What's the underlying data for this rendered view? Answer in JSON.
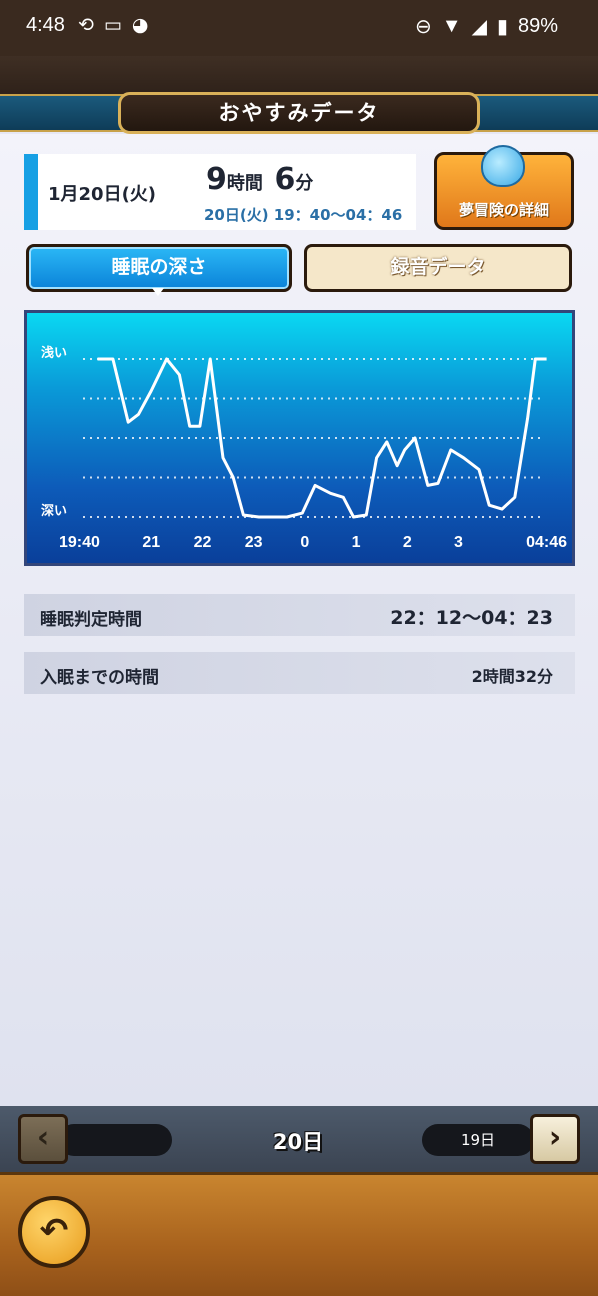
{
  "status_bar": {
    "time": "4:48",
    "battery": "89%"
  },
  "title": "おやすみデータ",
  "summary": {
    "date": "1月20日(火)",
    "hours": "9",
    "hours_unit": "時間",
    "minutes": "6",
    "minutes_unit": "分",
    "range": "20日(火) 19：40～04：46"
  },
  "adventure_button": "夢冒険の詳細",
  "tabs": {
    "depth": "睡眠の深さ",
    "recording": "録音データ"
  },
  "chart_data": {
    "type": "line",
    "ylabels": {
      "top": "浅い",
      "bottom": "深い"
    },
    "x_tick_labels": [
      "19:40",
      "21",
      "22",
      "23",
      "0",
      "1",
      "2",
      "3",
      "04:46"
    ],
    "x_tick_hours": [
      19.667,
      21,
      22,
      23,
      24,
      25,
      26,
      27,
      28.767
    ],
    "ylim": [
      0,
      4
    ],
    "x": [
      19.95,
      20.25,
      20.55,
      20.75,
      21.0,
      21.3,
      21.55,
      21.75,
      21.95,
      22.15,
      22.4,
      22.6,
      22.8,
      23.1,
      23.4,
      23.65,
      23.95,
      24.2,
      24.5,
      24.75,
      24.95,
      25.2,
      25.4,
      25.6,
      25.8,
      25.95,
      26.15,
      26.4,
      26.6,
      26.85,
      27.1,
      27.4,
      27.6,
      27.85,
      28.1,
      28.35,
      28.5,
      28.72
    ],
    "y": [
      4,
      4,
      2.4,
      2.6,
      3.2,
      4,
      3.6,
      2.3,
      2.3,
      4,
      1.5,
      1,
      0.05,
      0,
      0,
      0,
      0.1,
      0.8,
      0.6,
      0.5,
      0,
      0.05,
      1.5,
      1.9,
      1.3,
      1.7,
      2.0,
      0.8,
      0.85,
      1.7,
      1.5,
      1.2,
      0.3,
      0.2,
      0.5,
      2.5,
      4,
      4
    ],
    "grid": true
  },
  "rows": [
    {
      "label": "睡眠判定時間",
      "value": "22：12～04：23"
    },
    {
      "label": "入眠までの時間",
      "value": "2時間32分"
    }
  ],
  "nav": {
    "current": "20日",
    "next": "19日",
    "prev": ""
  },
  "icons": {
    "prev": "chevron-left-icon",
    "next": "chevron-right-icon",
    "back": "return-icon",
    "slime": "slime-icon"
  },
  "colors": {
    "accent": "#17a0e4",
    "orange": "#e0781a"
  }
}
